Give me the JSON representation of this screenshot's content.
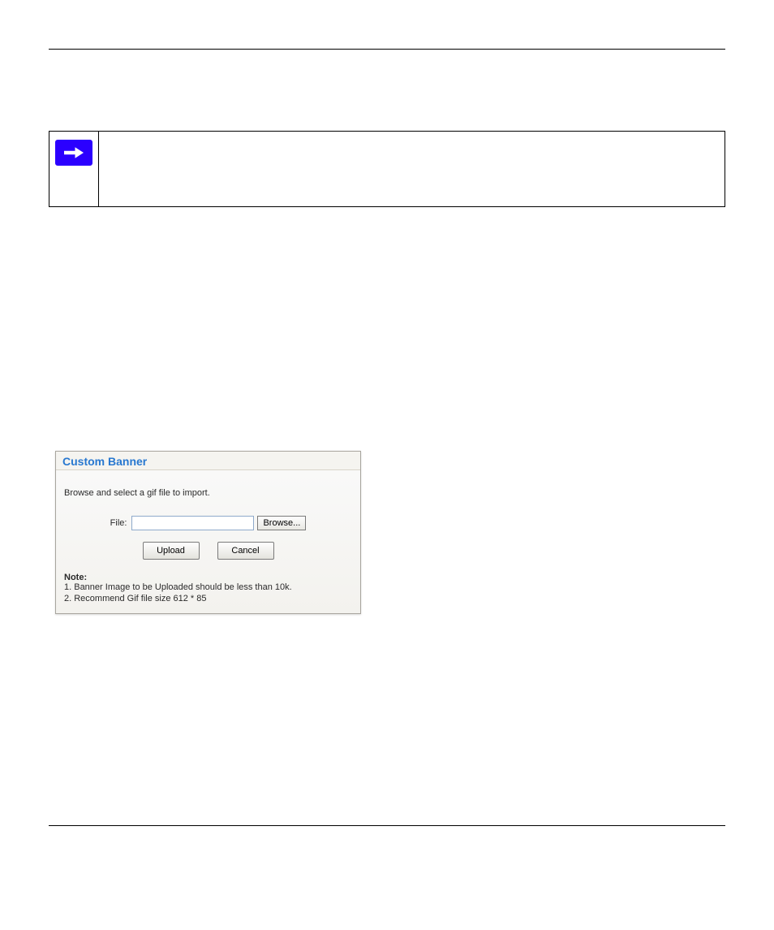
{
  "dialog": {
    "title": "Custom Banner",
    "instruction": "Browse and select a gif file to import.",
    "file_label": "File:",
    "file_value": "",
    "browse_label": "Browse...",
    "upload_label": "Upload",
    "cancel_label": "Cancel",
    "note_heading": "Note:",
    "note_line1": "1. Banner Image to be Uploaded should be less than 10k.",
    "note_line2": "2. Recommend Gif file size 612 * 85"
  }
}
